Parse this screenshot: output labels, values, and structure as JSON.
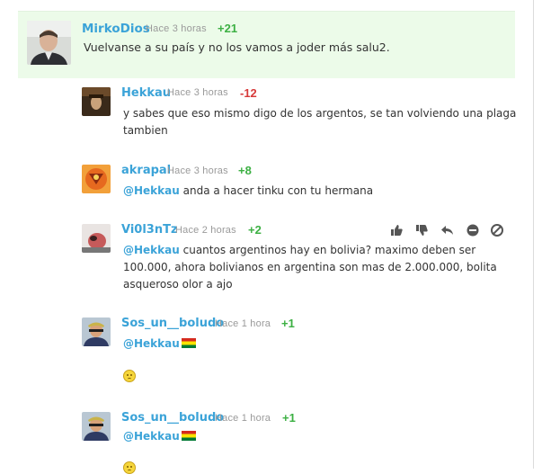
{
  "comments": [
    {
      "author": "MirkoDios",
      "time": "Hace 3 horas",
      "score": "+21",
      "lines": [
        "Vuelvanse a su país y no los vamos a joder más salu2."
      ]
    },
    {
      "author": "Hekkau",
      "time": "Hace 3 horas",
      "score": "-12",
      "lines": [
        "y sabes que eso mismo digo de los argentos, se tan volviendo una plaga",
        "tambien"
      ]
    },
    {
      "author": "akrapal",
      "time": "Hace 3 horas",
      "score": "+8",
      "mention": "@Hekkau",
      "lines": [
        " anda a hacer tinku con tu hermana"
      ]
    },
    {
      "author": "Vi0l3nTz",
      "time": "Hace 2 horas",
      "score": "+2",
      "mention": "@Hekkau",
      "lines": [
        " cuantos argentinos hay en bolivia? maximo deben ser",
        "100.000, ahora bolivianos en argentina son mas de 2.000.000, bolita",
        "asqueroso olor a ajo"
      ]
    },
    {
      "author": "Sos_un__boludo",
      "time": "Hace 1 hora",
      "score": "+1",
      "mention": "@Hekkau"
    },
    {
      "author": "Sos_un__boludo",
      "time": "Hace 1 hora",
      "score": "+1",
      "mention": "@Hekkau"
    }
  ],
  "actions": [
    "thumbs-up-icon",
    "thumbs-down-icon",
    "reply-icon",
    "minus-circle-icon",
    "ban-icon"
  ],
  "colors": {
    "author": "#3ba3d8",
    "positive": "#3cb043",
    "negative": "#d73a3a",
    "highlight_bg": "#ecfbe9",
    "timestamp": "#9a9a9a"
  }
}
